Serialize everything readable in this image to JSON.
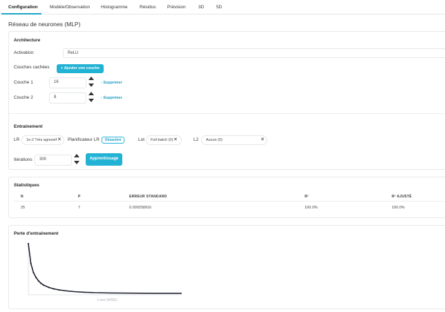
{
  "tabs": [
    {
      "label": "Configuration"
    },
    {
      "label": "Modèle/Observation"
    },
    {
      "label": "Histogramme"
    },
    {
      "label": "Résidus"
    },
    {
      "label": "Prévision"
    },
    {
      "label": "3D"
    },
    {
      "label": "5D"
    }
  ],
  "page_title": "Réseau de neurones (MLP)",
  "architecture": {
    "title": "Architecture",
    "activation_label": "Activation:",
    "activation_value": "ReLU",
    "hidden_layers_label": "Couches cachées",
    "add_layer_label": "+ Ajouter une couche",
    "layers": [
      {
        "label": "Couche 1",
        "value": "16",
        "delete_label": "- Supprimer"
      },
      {
        "label": "Couche 2",
        "value": "8",
        "delete_label": "- Supprimer"
      }
    ]
  },
  "training": {
    "title": "Entrainement",
    "lr_label": "LR",
    "lr_value": "1e-2 Très agressif",
    "scheduler_label": "Planificateur LR",
    "scheduler_badge": "Désactivé",
    "batch_label": "Lot",
    "batch_value": "Full-batch (0)",
    "l2_label": "L2",
    "l2_value": "Aucun (0)",
    "iterations_label": "Itérations",
    "iterations_value": "300",
    "train_button": "Apprentissage"
  },
  "statistics": {
    "title": "Statistiques",
    "headers": [
      "N",
      "P",
      "ERREUR STANDARD",
      "R²",
      "R² AJUSTÉ"
    ],
    "row": [
      "25",
      "7",
      "0.000258916",
      "100.0%",
      "100.0%"
    ]
  },
  "loss_chart": {
    "title": "Perte d'entrainement",
    "xlabel": "Loss (MSE)",
    "line_color": "#1f1f2e"
  },
  "chart_data": {
    "type": "line",
    "title": "Perte d'entrainement",
    "xlabel": "Loss (MSE)",
    "ylabel": "",
    "series": [
      {
        "x": [
          0,
          5,
          10,
          15,
          20,
          25,
          30,
          40,
          50,
          60,
          75,
          90,
          110,
          130,
          160,
          200,
          250,
          300
        ],
        "values": [
          1.0,
          0.6,
          0.42,
          0.32,
          0.25,
          0.2,
          0.165,
          0.12,
          0.09,
          0.07,
          0.05,
          0.035,
          0.022,
          0.014,
          0.008,
          0.004,
          0.002,
          0.001
        ]
      }
    ]
  }
}
